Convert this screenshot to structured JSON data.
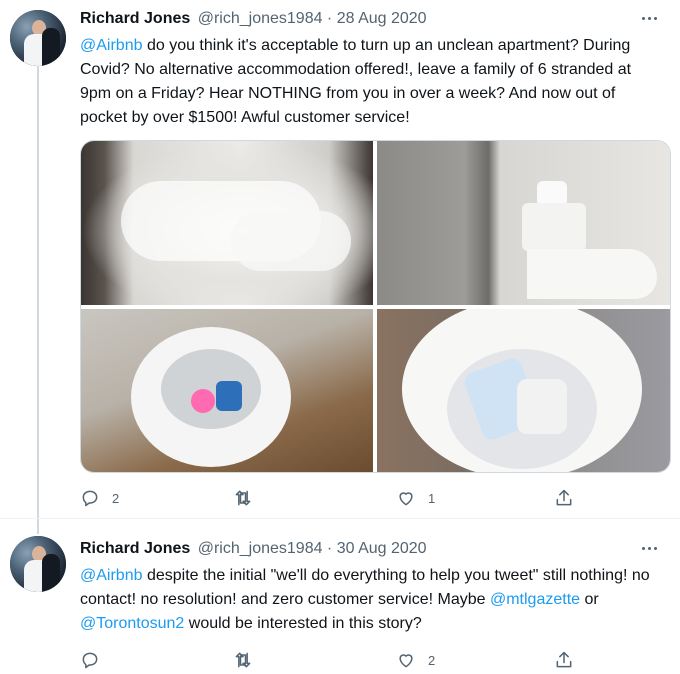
{
  "tweets": [
    {
      "author_name": "Richard Jones",
      "handle": "@rich_jones1984",
      "dot": " · ",
      "date": "28 Aug 2020",
      "text": {
        "m1": "@Airbnb",
        "t1": " do you think it's acceptable to turn up an unclean apartment? During Covid? No alternative accommodation offered!, leave a family of 6 stranded at 9pm on a Friday? Hear NOTHING from you in over a week? And now out of pocket by over $1500! Awful customer service!"
      },
      "photos": [
        "unmade-bed-photo",
        "toilet-photo",
        "trash-bin-bottles-photo",
        "trash-bin-mask-photo"
      ],
      "replies": "2",
      "retweets": "",
      "likes": "1"
    },
    {
      "author_name": "Richard Jones",
      "handle": "@rich_jones1984",
      "dot": " · ",
      "date": "30 Aug 2020",
      "text": {
        "m1": "@Airbnb",
        "t1": " despite the initial \"we'll do everything to help you tweet\" still nothing! no contact! no resolution! and zero customer service! Maybe ",
        "m2": "@mtlgazette",
        "t2": " or ",
        "m3": "@Torontosun2",
        "t3": " would be interested in this story?"
      },
      "replies": "",
      "retweets": "",
      "likes": "2"
    }
  ],
  "colors": {
    "link": "#1d9bf0",
    "muted": "#536471",
    "text": "#0f1419"
  },
  "icons": [
    "more-icon",
    "reply-icon",
    "retweet-icon",
    "like-icon",
    "share-icon"
  ]
}
